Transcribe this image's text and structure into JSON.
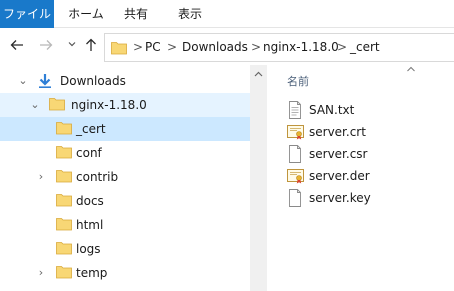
{
  "ribbon": {
    "tabs": [
      "ファイル",
      "ホーム",
      "共有",
      "表示"
    ]
  },
  "nav": {
    "back_icon": "arrow-left-icon",
    "forward_icon": "arrow-right-icon",
    "recent_icon": "chevron-down-icon",
    "up_icon": "arrow-up-icon"
  },
  "address": {
    "crumbs": [
      "PC",
      "Downloads",
      "nginx-1.18.0",
      "_cert"
    ],
    "separator": ">"
  },
  "tree": {
    "items": [
      {
        "label": "Downloads",
        "icon": "download-icon",
        "expanded": true
      },
      {
        "label": "nginx-1.18.0",
        "icon": "folder-icon",
        "expanded": true
      },
      {
        "label": "_cert",
        "icon": "folder-icon",
        "selected": true
      },
      {
        "label": "conf",
        "icon": "folder-icon"
      },
      {
        "label": "contrib",
        "icon": "folder-icon",
        "expandable": true
      },
      {
        "label": "docs",
        "icon": "folder-icon"
      },
      {
        "label": "html",
        "icon": "folder-icon"
      },
      {
        "label": "logs",
        "icon": "folder-icon"
      },
      {
        "label": "temp",
        "icon": "folder-icon",
        "expandable": true
      }
    ],
    "chevron_expanded": "⌄",
    "chevron_collapsed": "›"
  },
  "content": {
    "column_header": "名前",
    "files": [
      {
        "name": "SAN.txt",
        "icon": "text-file-icon"
      },
      {
        "name": "server.crt",
        "icon": "certificate-icon"
      },
      {
        "name": "server.csr",
        "icon": "file-icon"
      },
      {
        "name": "server.der",
        "icon": "certificate-icon"
      },
      {
        "name": "server.key",
        "icon": "file-icon"
      }
    ]
  },
  "colors": {
    "accent": "#1979ca",
    "selection": "#cce8ff",
    "hover": "#e5f3ff",
    "folder": "#f8d775"
  }
}
